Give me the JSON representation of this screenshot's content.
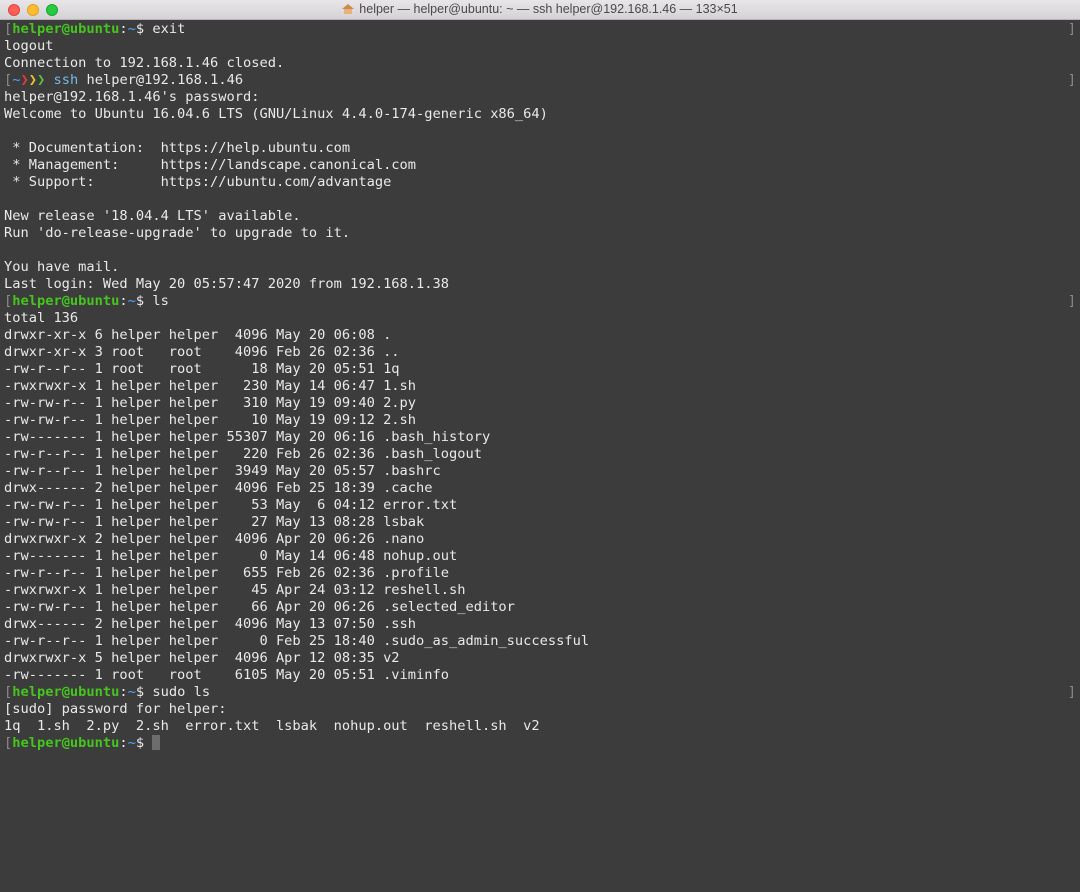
{
  "window": {
    "title": "helper — helper@ubuntu: ~ — ssh helper@192.168.1.46 — 133×51"
  },
  "prompt": {
    "user_host": "helper@ubuntu",
    "sep": ":",
    "path": "~",
    "dollar": "$"
  },
  "cmd": {
    "exit": "exit",
    "ls": "ls",
    "sudo_ls": "sudo ls"
  },
  "local_prompt": {
    "open": "[",
    "dash": "~",
    "arrows": [
      "❯",
      "❯",
      "❯"
    ],
    "ssh": "ssh",
    "target": "helper@192.168.1.46"
  },
  "output": {
    "logout": "logout",
    "closed": "Connection to 192.168.1.46 closed.",
    "password": "helper@192.168.1.46's password:",
    "welcome": "Welcome to Ubuntu 16.04.6 LTS (GNU/Linux 4.4.0-174-generic x86_64)",
    "doc": " * Documentation:  https://help.ubuntu.com",
    "mgmt": " * Management:     https://landscape.canonical.com",
    "support": " * Support:        https://ubuntu.com/advantage",
    "release": "New release '18.04.4 LTS' available.",
    "upgrade": "Run 'do-release-upgrade' to upgrade to it.",
    "mail": "You have mail.",
    "last_login": "Last login: Wed May 20 05:57:47 2020 from 192.168.1.38",
    "total": "total 136",
    "sudo_prompt": "[sudo] password for helper:",
    "sudo_result": "1q  1.sh  2.py  2.sh  error.txt  lsbak  nohup.out  reshell.sh  v2"
  },
  "listing": [
    "drwxr-xr-x 6 helper helper  4096 May 20 06:08 .",
    "drwxr-xr-x 3 root   root    4096 Feb 26 02:36 ..",
    "-rw-r--r-- 1 root   root      18 May 20 05:51 1q",
    "-rwxrwxr-x 1 helper helper   230 May 14 06:47 1.sh",
    "-rw-rw-r-- 1 helper helper   310 May 19 09:40 2.py",
    "-rw-rw-r-- 1 helper helper    10 May 19 09:12 2.sh",
    "-rw------- 1 helper helper 55307 May 20 06:16 .bash_history",
    "-rw-r--r-- 1 helper helper   220 Feb 26 02:36 .bash_logout",
    "-rw-r--r-- 1 helper helper  3949 May 20 05:57 .bashrc",
    "drwx------ 2 helper helper  4096 Feb 25 18:39 .cache",
    "-rw-rw-r-- 1 helper helper    53 May  6 04:12 error.txt",
    "-rw-rw-r-- 1 helper helper    27 May 13 08:28 lsbak",
    "drwxrwxr-x 2 helper helper  4096 Apr 20 06:26 .nano",
    "-rw------- 1 helper helper     0 May 14 06:48 nohup.out",
    "-rw-r--r-- 1 helper helper   655 Feb 26 02:36 .profile",
    "-rwxrwxr-x 1 helper helper    45 Apr 24 03:12 reshell.sh",
    "-rw-rw-r-- 1 helper helper    66 Apr 20 06:26 .selected_editor",
    "drwx------ 2 helper helper  4096 May 13 07:50 .ssh",
    "-rw-r--r-- 1 helper helper     0 Feb 25 18:40 .sudo_as_admin_successful",
    "drwxrwxr-x 5 helper helper  4096 Apr 12 08:35 v2",
    "-rw------- 1 root   root    6105 May 20 05:51 .viminfo"
  ]
}
